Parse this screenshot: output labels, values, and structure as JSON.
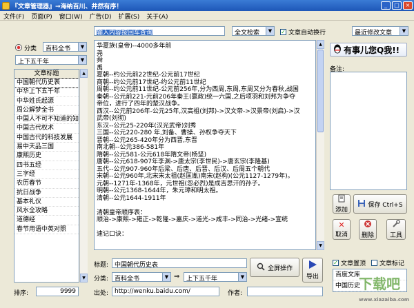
{
  "window": {
    "title": "『文章管理器』→海纳百川、井然有序！"
  },
  "menu": [
    "文件(F)",
    "页面(P)",
    "窗口(W)",
    "广告(D)",
    "扩展(S)",
    "关于(A)"
  ],
  "search": {
    "placeholder": "输入内容按回车查询",
    "mode": "全文检索",
    "auto_wrap_label": "文章自动换行",
    "sort": "最近修改文章"
  },
  "category": {
    "label": "分类",
    "primary": "百科全书",
    "secondary": "上下五千年"
  },
  "list": {
    "header": "文章标题",
    "items": [
      "中国朝代历史表",
      "中华上下五千年",
      "中华姓氏起源",
      "周公解梦全书",
      "中国人不可不知道的知识",
      "中国古代权术",
      "中国古代的科技发展",
      "易中天品三国",
      "康熙历史",
      "四书五经",
      "三字经",
      "农历春节",
      "抗日战争",
      "基本礼仪",
      "风水全攻略",
      "道德经",
      "春节用语中英对照"
    ]
  },
  "editor": {
    "lines": [
      "华夏族(皇帝)--4000多年前",
      "尧",
      "舜",
      "禹",
      "夏朝--约公元前22世纪-公元前17世纪",
      "商朝--约公元前17世纪-约公元前11世纪",
      "周朝--约公元前11世纪-公元前256年,分为西周,东周,东周又分为春秋,战国",
      "秦朝--公元前221-元前206年秦王(嬴政)统一六国,之后项羽和刘邦为争夺",
      "帝位，进行了四年的楚汉战争。",
      "西汉--公元前206年-公元25年,汉高祖(刘邦)->汉文帝->汉景帝(刘启)->汉",
      "武帝(刘彻)",
      "东汉--公元25-220年(汉光武帝)刘秀",
      "三国--公元220-280 年,刘备、曹操、孙权争夺天下",
      "晋朝--公元265-420年分为西晋,东晋",
      "南北朝--公元386-581年",
      "隋朝--公元581-公元618年隋文帝(杨坚)",
      "唐朝--公元618-907年李渊->唐太宗(李世民)->唐玄宗(李隆基)",
      "五代--公元907-960年后梁、后唐、后晋、后汉、后周五个朝代",
      "宋朝--公元960年,北宋宋太祖(赵匡胤)南宋(赵构)(公元1127-1279年)。",
      "元朝--1271年-1368年，元世祖(忽必烈)是成吉思汗的孙子。",
      "明朝--公元1368-1644年，朱元璋和明太祖。",
      "清朝--公元1644-1911年",
      "",
      "清朝皇帝顺序表：",
      "顺治->康熙->雍正->乾隆->嘉庆->道光->咸丰->同治->光绪->宣统",
      "",
      "速记口诀："
    ]
  },
  "form": {
    "title_label": "标题:",
    "title_value": "中国朝代历史表",
    "cat_label": "分类:",
    "cat_primary": "百科全书",
    "cat_secondary": "上下五千年",
    "source_label": "出处:",
    "source_value": "http://wenku.baidu.com/",
    "author_label": "作者:",
    "author_value": "",
    "order_label": "排序:",
    "order_value": "9999"
  },
  "buttons": {
    "fullscreen": "全屏操作",
    "export": "导出",
    "add": "添加",
    "save": "保存 Ctrl+S",
    "cancel": "取消",
    "delete": "删除",
    "tools": "工具"
  },
  "right": {
    "qq": "有事儿您Q我!!",
    "notes_label": "备注:",
    "chk_summary": "文章置顶",
    "chk_mark": "文章标记",
    "mini_list": [
      "百度文库",
      "中国历史"
    ]
  },
  "watermark": {
    "text": "下载吧",
    "url": "www.xiazaiba.com"
  }
}
